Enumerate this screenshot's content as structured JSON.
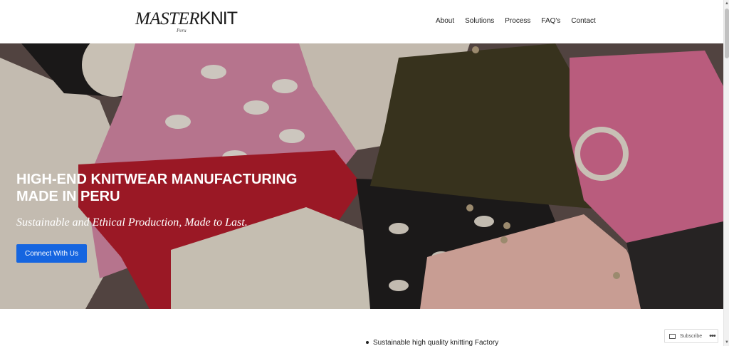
{
  "header": {
    "logo_main_a": "MASTER",
    "logo_main_b": "KNIT",
    "logo_sub": "Peru",
    "nav": [
      "About",
      "Solutions",
      "Process",
      "FAQ's",
      "Contact"
    ]
  },
  "hero": {
    "title_line1": "HIGH-END KNITWEAR MANUFACTURING",
    "title_line2": "MADE IN PERU",
    "subtitle": "Sustainable and Ethical Production, Made to Last.",
    "cta_label": "Connect With Us"
  },
  "content": {
    "bullet1": "Sustainable high quality knitting Factory"
  },
  "widget": {
    "subscribe_label": "Subscribe",
    "more": "•••"
  },
  "colors": {
    "cta": "#1565e0",
    "cream": "#efe8dc",
    "pink": "#d7709a",
    "red": "#c2182b",
    "olive": "#3f3a1e"
  }
}
